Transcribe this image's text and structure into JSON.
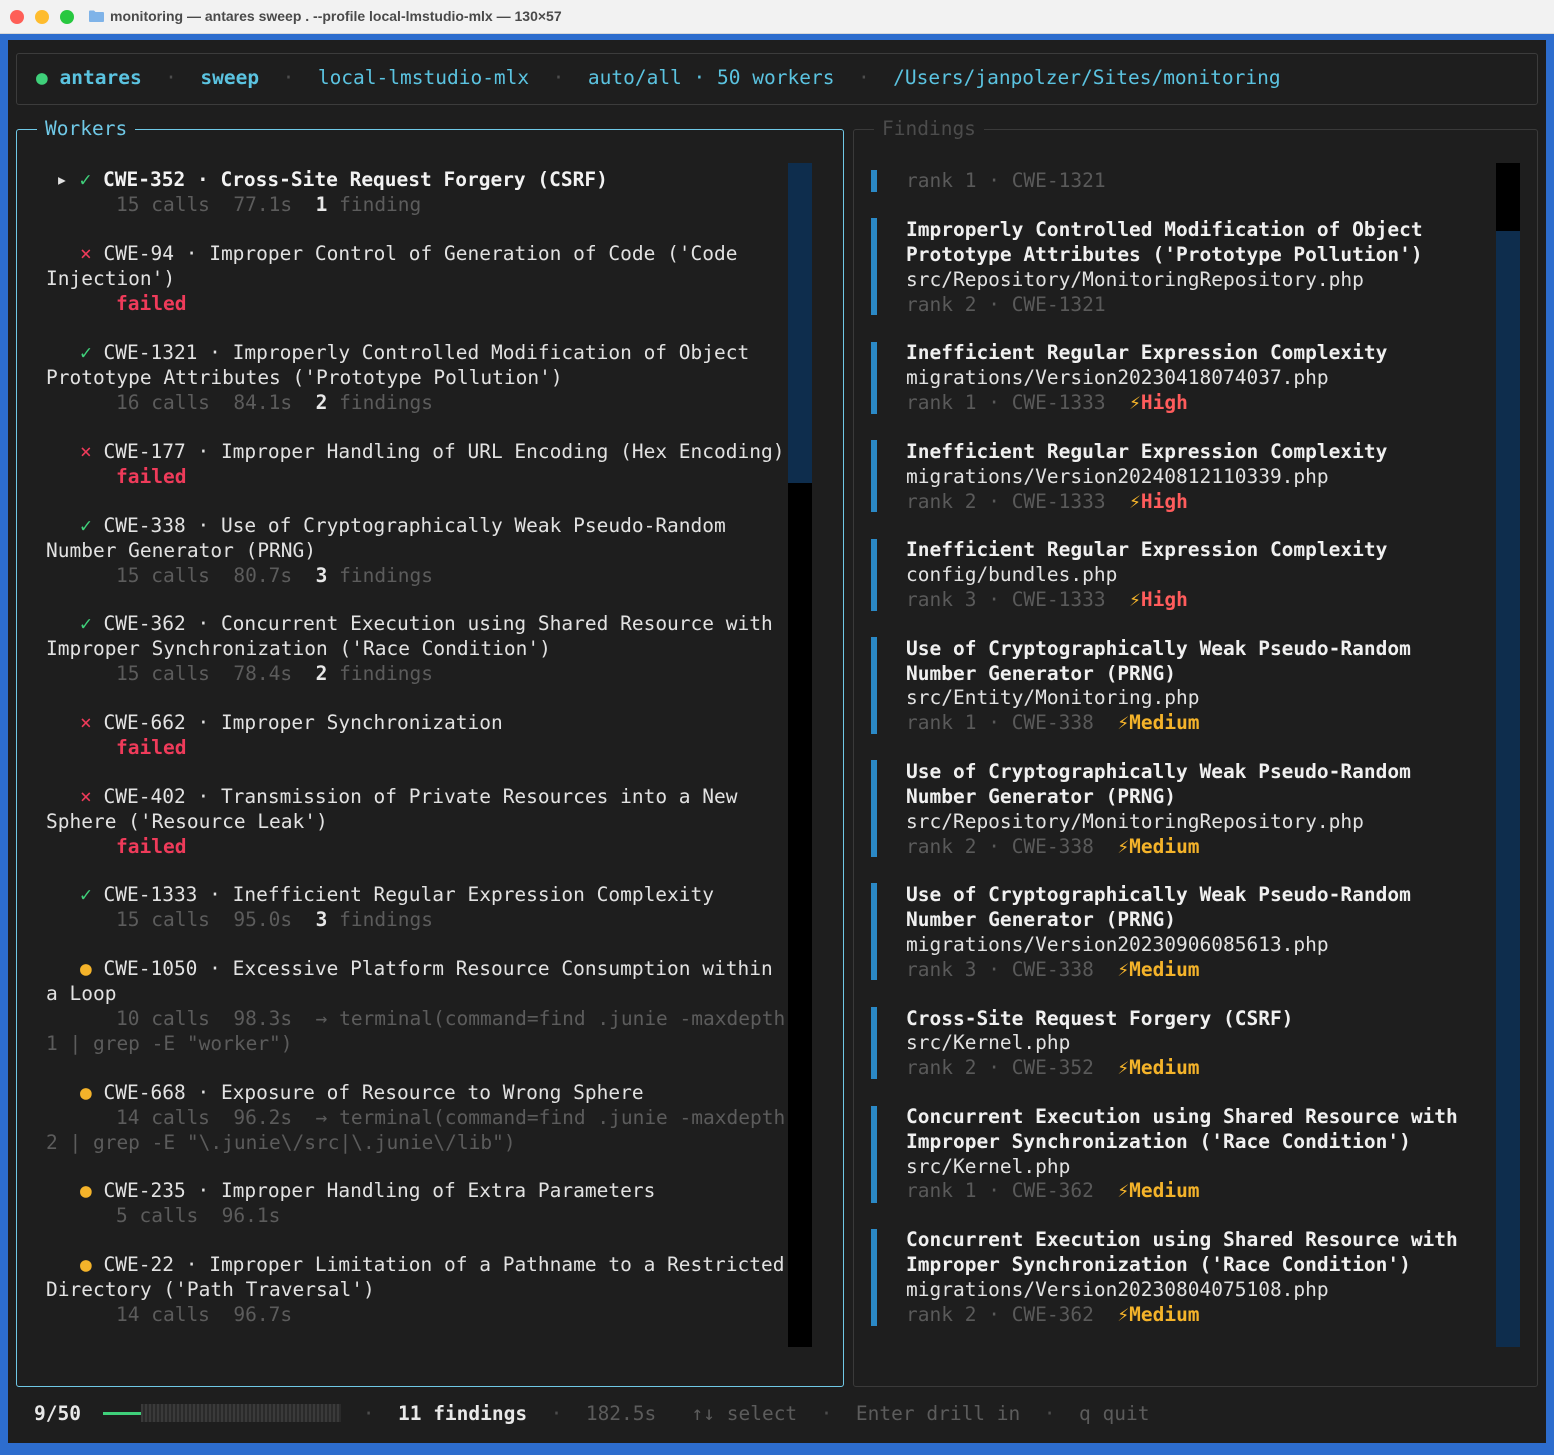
{
  "window": {
    "title": "monitoring — antares sweep . --profile local-lmstudio-mlx — 130×57"
  },
  "header": {
    "app": "antares",
    "mode": "sweep",
    "profile": "local-lmstudio-mlx",
    "scope": "auto/all",
    "workers": "50 workers",
    "path": "/Users/janpolzer/Sites/monitoring"
  },
  "workers_panel": {
    "title": "Workers",
    "items": [
      {
        "cwe": "CWE-352",
        "name_l1": "Cross-Site Request Forgery (CSRF)",
        "calls": "15 calls",
        "time": "77.1s",
        "count": "1",
        "count_label": "finding"
      },
      {
        "cwe": "CWE-94",
        "name_l1": "Improper Control of Generation of Code ('Code",
        "name_l2": "Injection')",
        "status": "failed"
      },
      {
        "cwe": "CWE-1321",
        "name_l1": "Improperly Controlled Modification of Object",
        "name_l2": "Prototype Attributes ('Prototype Pollution')",
        "calls": "16 calls",
        "time": "84.1s",
        "count": "2",
        "count_label": "findings"
      },
      {
        "cwe": "CWE-177",
        "name_l1": "Improper Handling of URL Encoding (Hex Encoding)",
        "status": "failed"
      },
      {
        "cwe": "CWE-338",
        "name_l1": "Use of Cryptographically Weak Pseudo-Random",
        "name_l2": "Number Generator (PRNG)",
        "calls": "15 calls",
        "time": "80.7s",
        "count": "3",
        "count_label": "findings"
      },
      {
        "cwe": "CWE-362",
        "name_l1": "Concurrent Execution using Shared Resource with",
        "name_l2": "Improper Synchronization ('Race Condition')",
        "calls": "15 calls",
        "time": "78.4s",
        "count": "2",
        "count_label": "findings"
      },
      {
        "cwe": "CWE-662",
        "name_l1": "Improper Synchronization",
        "status": "failed"
      },
      {
        "cwe": "CWE-402",
        "name_l1": "Transmission of Private Resources into a New",
        "name_l2": "Sphere ('Resource Leak')",
        "status": "failed"
      },
      {
        "cwe": "CWE-1333",
        "name_l1": "Inefficient Regular Expression Complexity",
        "calls": "15 calls",
        "time": "95.0s",
        "count": "3",
        "count_label": "findings"
      },
      {
        "cwe": "CWE-1050",
        "name_l1": "Excessive Platform Resource Consumption within",
        "name_l2": "a Loop",
        "calls": "10 calls",
        "time": "98.3s",
        "activity_l1": "→ terminal(command=find .junie -maxdepth",
        "activity_l2": "1 | grep -E \"worker\")"
      },
      {
        "cwe": "CWE-668",
        "name_l1": "Exposure of Resource to Wrong Sphere",
        "calls": "14 calls",
        "time": "96.2s",
        "activity_l1": "→ terminal(command=find .junie -maxdepth",
        "activity_l2": "2 | grep -E \"\\.junie\\/src|\\.junie\\/lib\")"
      },
      {
        "cwe": "CWE-235",
        "name_l1": "Improper Handling of Extra Parameters",
        "calls": "5 calls",
        "time": "96.1s"
      },
      {
        "cwe": "CWE-22",
        "name_l1": "Improper Limitation of a Pathname to a Restricted",
        "name_l2": "Directory ('Path Traversal')",
        "calls": "14 calls",
        "time": "96.7s"
      }
    ]
  },
  "findings_panel": {
    "title": "Findings",
    "top_rank": {
      "rank": "rank 1",
      "cwe": "CWE-1321"
    },
    "items": [
      {
        "t1": "Improperly Controlled Modification of Object",
        "t2": "Prototype Attributes ('Prototype Pollution')",
        "path": "src/Repository/MonitoringRepository.php",
        "rank": "rank 2",
        "cwe": "CWE-1321"
      },
      {
        "t1": "Inefficient Regular Expression Complexity",
        "path": "migrations/Version20230418074037.php",
        "rank": "rank 1",
        "cwe": "CWE-1333",
        "severity": "High"
      },
      {
        "t1": "Inefficient Regular Expression Complexity",
        "path": "migrations/Version20240812110339.php",
        "rank": "rank 2",
        "cwe": "CWE-1333",
        "severity": "High"
      },
      {
        "t1": "Inefficient Regular Expression Complexity",
        "path": "config/bundles.php",
        "rank": "rank 3",
        "cwe": "CWE-1333",
        "severity": "High"
      },
      {
        "t1": "Use of Cryptographically Weak Pseudo-Random",
        "t2": "Number Generator (PRNG)",
        "path": "src/Entity/Monitoring.php",
        "rank": "rank 1",
        "cwe": "CWE-338",
        "severity": "Medium"
      },
      {
        "t1": "Use of Cryptographically Weak Pseudo-Random",
        "t2": "Number Generator (PRNG)",
        "path": "src/Repository/MonitoringRepository.php",
        "rank": "rank 2",
        "cwe": "CWE-338",
        "severity": "Medium"
      },
      {
        "t1": "Use of Cryptographically Weak Pseudo-Random",
        "t2": "Number Generator (PRNG)",
        "path": "migrations/Version20230906085613.php",
        "rank": "rank 3",
        "cwe": "CWE-338",
        "severity": "Medium"
      },
      {
        "t1": "Cross-Site Request Forgery (CSRF)",
        "path": "src/Kernel.php",
        "rank": "rank 2",
        "cwe": "CWE-352",
        "severity": "Medium"
      },
      {
        "t1": "Concurrent Execution using Shared Resource with",
        "t2": "Improper Synchronization ('Race Condition')",
        "path": "src/Kernel.php",
        "rank": "rank 1",
        "cwe": "CWE-362",
        "severity": "Medium"
      },
      {
        "t1": "Concurrent Execution using Shared Resource with",
        "t2": "Improper Synchronization ('Race Condition')",
        "path": "migrations/Version20230804075108.php",
        "rank": "rank 2",
        "cwe": "CWE-362",
        "severity": "Medium"
      }
    ]
  },
  "footer": {
    "progress": "9/50",
    "progress_fraction": 0.18,
    "findings": "11 findings",
    "elapsed": "182.5s",
    "hint_select": "↑↓ select",
    "hint_drill": "Enter drill in",
    "hint_quit": "q quit"
  },
  "colors": {
    "accent": "#5bc3e0",
    "ok": "#3fd07a",
    "failed": "#ef3b5a",
    "running": "#f4b32a",
    "high": "#ff5c5c",
    "medium": "#f4b32a",
    "frame": "#2d6dce"
  },
  "icons": {
    "ok": "check-icon",
    "fail": "cross-icon",
    "running": "dot-icon",
    "selected": "triangle-right-icon",
    "severity": "lightning-icon"
  }
}
